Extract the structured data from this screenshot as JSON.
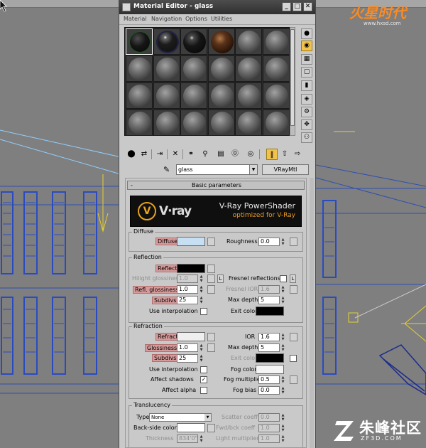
{
  "background": {
    "watermark_top_brand": "火星时代",
    "watermark_top_url": "www.hxsd.com",
    "watermark_bottom_brand": "朱峰社区",
    "watermark_bottom_url": "ZF3D.COM"
  },
  "window": {
    "title": "Material Editor - glass",
    "minimize": "_",
    "maximize": "□",
    "close": "✕"
  },
  "menu": [
    "Material",
    "Navigation",
    "Options",
    "Utilities"
  ],
  "slots": {
    "rows": 4,
    "cols": 6,
    "special": [
      "glass",
      "glassb",
      "black",
      "brown"
    ],
    "selected_index": 0
  },
  "side_toolbar_icons": [
    "sample-type-icon",
    "backlight-icon",
    "background-icon",
    "sample-uv-icon",
    "video-color-check-icon",
    "make-preview-icon",
    "options-icon",
    "select-by-material-icon",
    "material-map-navigator-icon"
  ],
  "bottom_toolbar_icons": [
    "get-material-icon",
    "put-to-scene-icon",
    "assign-to-selection-icon",
    "reset-map-icon",
    "make-copy-icon",
    "make-unique-icon",
    "put-to-library-icon",
    "material-id-channel-icon",
    "show-map-in-viewport-icon",
    "show-end-result-icon",
    "go-to-parent-icon",
    "go-forward-icon"
  ],
  "material": {
    "name": "glass",
    "type": "VRayMtl"
  },
  "rollout": {
    "collapse": "-",
    "title": "Basic parameters"
  },
  "banner": {
    "logo": "V",
    "logo_text": "V·ray",
    "product": "V-Ray PowerShader",
    "tagline": "optimized for V-Ray"
  },
  "diffuse": {
    "group": "Diffuse",
    "diffuse_label": "Diffuse",
    "diffuse_color": "#c7dff2",
    "roughness_label": "Roughness",
    "roughness": "0.0"
  },
  "reflection": {
    "group": "Reflection",
    "reflect_label": "Reflect",
    "reflect_color": "#000000",
    "hilight_label": "Hilight glossiness",
    "hilight": "1.0",
    "L": "L",
    "fresnel_label": "Fresnel reflections",
    "refl_gloss_label": "Refl. glossiness",
    "refl_gloss": "1.0",
    "fresnel_ior_label": "Fresnel IOR",
    "fresnel_ior": "1.6",
    "subdivs_label": "Subdivs",
    "subdivs": "25",
    "max_depth_label": "Max depth",
    "max_depth": "5",
    "use_interp_label": "Use interpolation",
    "exit_color_label": "Exit color",
    "exit_color": "#000000"
  },
  "refraction": {
    "group": "Refraction",
    "refract_label": "Refract",
    "refract_color": "#efefef",
    "ior_label": "IOR",
    "ior": "1.6",
    "gloss_label": "Glossiness",
    "gloss": "1.0",
    "max_depth_label": "Max depth",
    "max_depth": "5",
    "subdivs_label": "Subdivs",
    "subdivs": "25",
    "exit_color_label": "Exit color",
    "exit_color": "#000000",
    "use_interp_label": "Use interpolation",
    "fog_color_label": "Fog color",
    "fog_color": "#f4f4f4",
    "affect_shadows_label": "Affect shadows",
    "affect_shadows_check": "✓",
    "fog_mult_label": "Fog multiplier",
    "fog_mult": "0.5",
    "affect_alpha_label": "Affect alpha",
    "fog_bias_label": "Fog bias",
    "fog_bias": "0.0"
  },
  "translucency": {
    "group": "Translucency",
    "type_label": "Type",
    "type": "None",
    "scatter_label": "Scatter coeff",
    "scatter": "0.0",
    "backside_label": "Back-side color",
    "backside_color": "#ffffff",
    "fwd_label": "Fwd/bck coeff",
    "fwd": "1.0",
    "thickness_label": "Thickness",
    "thickness": "834'0\"",
    "light_mult_label": "Light multiplier",
    "light_mult": "1.0"
  }
}
